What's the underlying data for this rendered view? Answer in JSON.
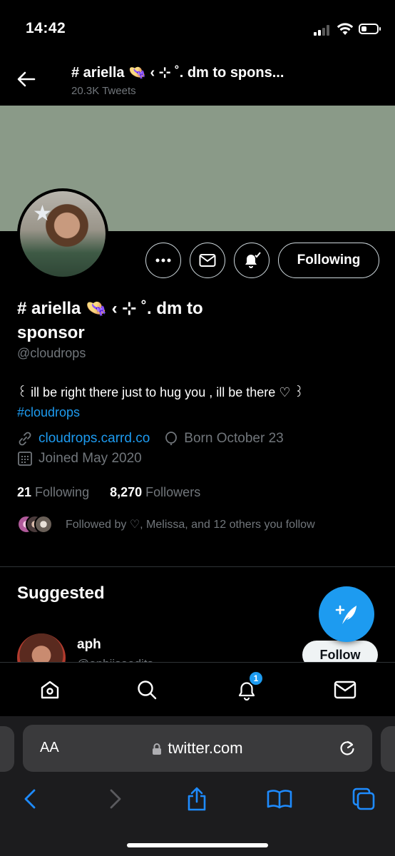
{
  "status_bar": {
    "time": "14:42",
    "icons": [
      "cellular-signal-icon",
      "wifi-icon",
      "battery-icon"
    ],
    "battery_level": 0.35
  },
  "header": {
    "back_icon": "arrow-left-icon",
    "title": "# ariella 👒 ‹ ⊹ ˚.  dm to spons...",
    "tweet_count": "20.3K Tweets"
  },
  "profile": {
    "banner_color": "#8a9a88",
    "display_name": "# ariella 👒 ‹ ⊹ ˚.  dm to sponsor",
    "handle": "@cloudrops",
    "bio_text": "꒰ ill be right there just to hug you , ill be there ♡ ꒱",
    "bio_hashtag": "#cloudrops",
    "website": "cloudrops.carrd.co",
    "birthday": "Born October 23",
    "joined": "Joined May 2020",
    "following_count": "21",
    "following_label": "Following",
    "followers_count": "8,270",
    "followers_label": "Followers",
    "followed_by": "Followed by ♡, Melissa, and 12 others you follow"
  },
  "actions": {
    "more_icon": "more-dots-icon",
    "message_icon": "envelope-icon",
    "notify_icon": "bell-check-icon",
    "following_label": "Following"
  },
  "suggested": {
    "title": "Suggested",
    "items": [
      {
        "name": "aph",
        "handle": "@aphjisoedits",
        "follow_label": "Follow"
      }
    ]
  },
  "compose": {
    "icon": "compose-feather-icon"
  },
  "bottom_nav": {
    "items": [
      "home-icon",
      "search-icon",
      "bell-icon",
      "mail-icon"
    ],
    "notification_badge": "1"
  },
  "safari": {
    "aa_label": "AA",
    "url": "twitter.com",
    "toolbar": [
      "back-icon",
      "forward-icon",
      "share-icon",
      "bookmarks-icon",
      "tabs-icon"
    ]
  },
  "colors": {
    "accent": "#1d9bf0",
    "background": "#000000",
    "secondary_text": "#71767b"
  }
}
